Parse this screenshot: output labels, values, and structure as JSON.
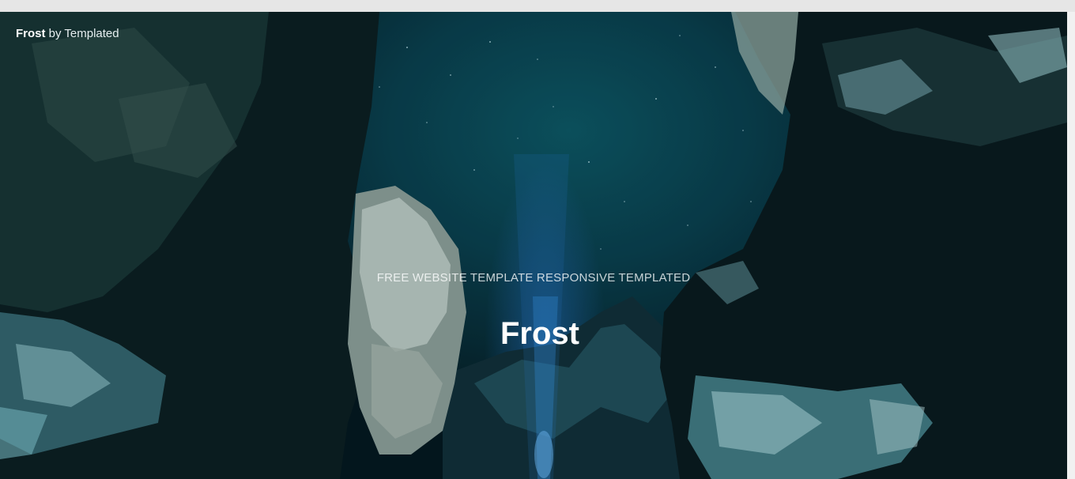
{
  "header": {
    "brand": "Frost",
    "brand_suffix": " by Templated"
  },
  "banner": {
    "subtitle": "FREE WEBSITE TEMPLATE RESPONSIVE TEMPLATED",
    "title": "Frost"
  }
}
